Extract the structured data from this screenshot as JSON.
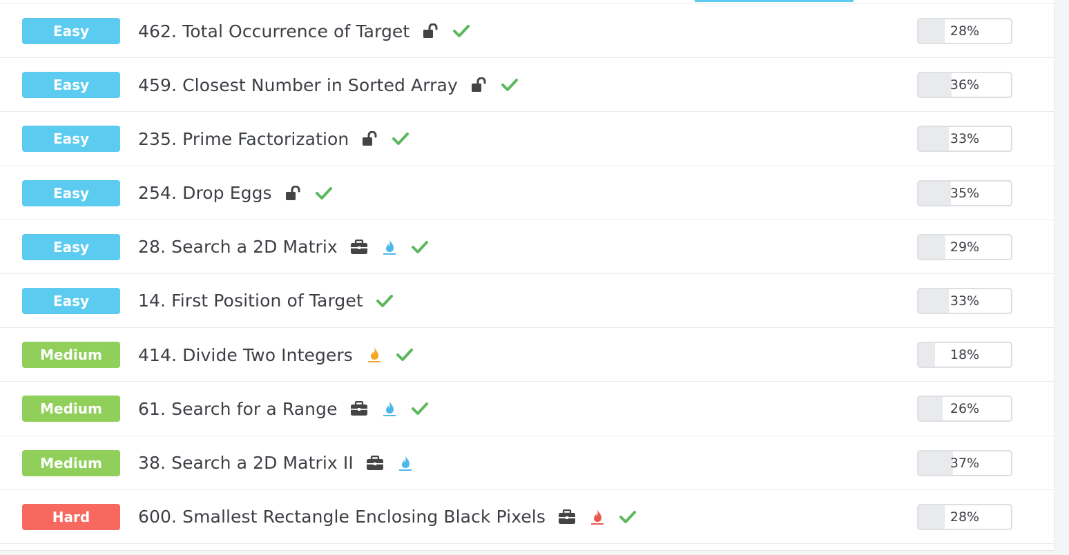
{
  "colors": {
    "easy": "#5ccbf0",
    "medium": "#8fcf5a",
    "hard": "#f7685f",
    "check": "#5cb85c",
    "lock": "#444444",
    "flame_blue": "#4ab8e8",
    "flame_orange": "#f5a623",
    "flame_red": "#e8584f"
  },
  "problems": [
    {
      "difficulty": "Easy",
      "level": "easy",
      "title": "462. Total Occurrence of Target",
      "icons": [
        "unlock-icon",
        "check-icon"
      ],
      "rate": "28%",
      "rate_value": 0.28
    },
    {
      "difficulty": "Easy",
      "level": "easy",
      "title": "459. Closest Number in Sorted Array",
      "icons": [
        "unlock-icon",
        "check-icon"
      ],
      "rate": "36%",
      "rate_value": 0.36
    },
    {
      "difficulty": "Easy",
      "level": "easy",
      "title": "235. Prime Factorization",
      "icons": [
        "unlock-icon",
        "check-icon"
      ],
      "rate": "33%",
      "rate_value": 0.33
    },
    {
      "difficulty": "Easy",
      "level": "easy",
      "title": "254. Drop Eggs",
      "icons": [
        "unlock-icon",
        "check-icon"
      ],
      "rate": "35%",
      "rate_value": 0.35
    },
    {
      "difficulty": "Easy",
      "level": "easy",
      "title": "28. Search a 2D Matrix",
      "icons": [
        "briefcase-icon",
        "flame-blue-icon",
        "check-icon"
      ],
      "rate": "29%",
      "rate_value": 0.29
    },
    {
      "difficulty": "Easy",
      "level": "easy",
      "title": "14. First Position of Target",
      "icons": [
        "check-icon"
      ],
      "rate": "33%",
      "rate_value": 0.33
    },
    {
      "difficulty": "Medium",
      "level": "medium",
      "title": "414. Divide Two Integers",
      "icons": [
        "flame-orange-icon",
        "check-icon"
      ],
      "rate": "18%",
      "rate_value": 0.18
    },
    {
      "difficulty": "Medium",
      "level": "medium",
      "title": "61. Search for a Range",
      "icons": [
        "briefcase-icon",
        "flame-blue-icon",
        "check-icon"
      ],
      "rate": "26%",
      "rate_value": 0.26
    },
    {
      "difficulty": "Medium",
      "level": "medium",
      "title": "38. Search a 2D Matrix II",
      "icons": [
        "briefcase-icon",
        "flame-blue-icon"
      ],
      "rate": "37%",
      "rate_value": 0.37
    },
    {
      "difficulty": "Hard",
      "level": "hard",
      "title": "600. Smallest Rectangle Enclosing Black Pixels",
      "icons": [
        "briefcase-icon",
        "flame-red-icon",
        "check-icon"
      ],
      "rate": "28%",
      "rate_value": 0.28
    }
  ]
}
